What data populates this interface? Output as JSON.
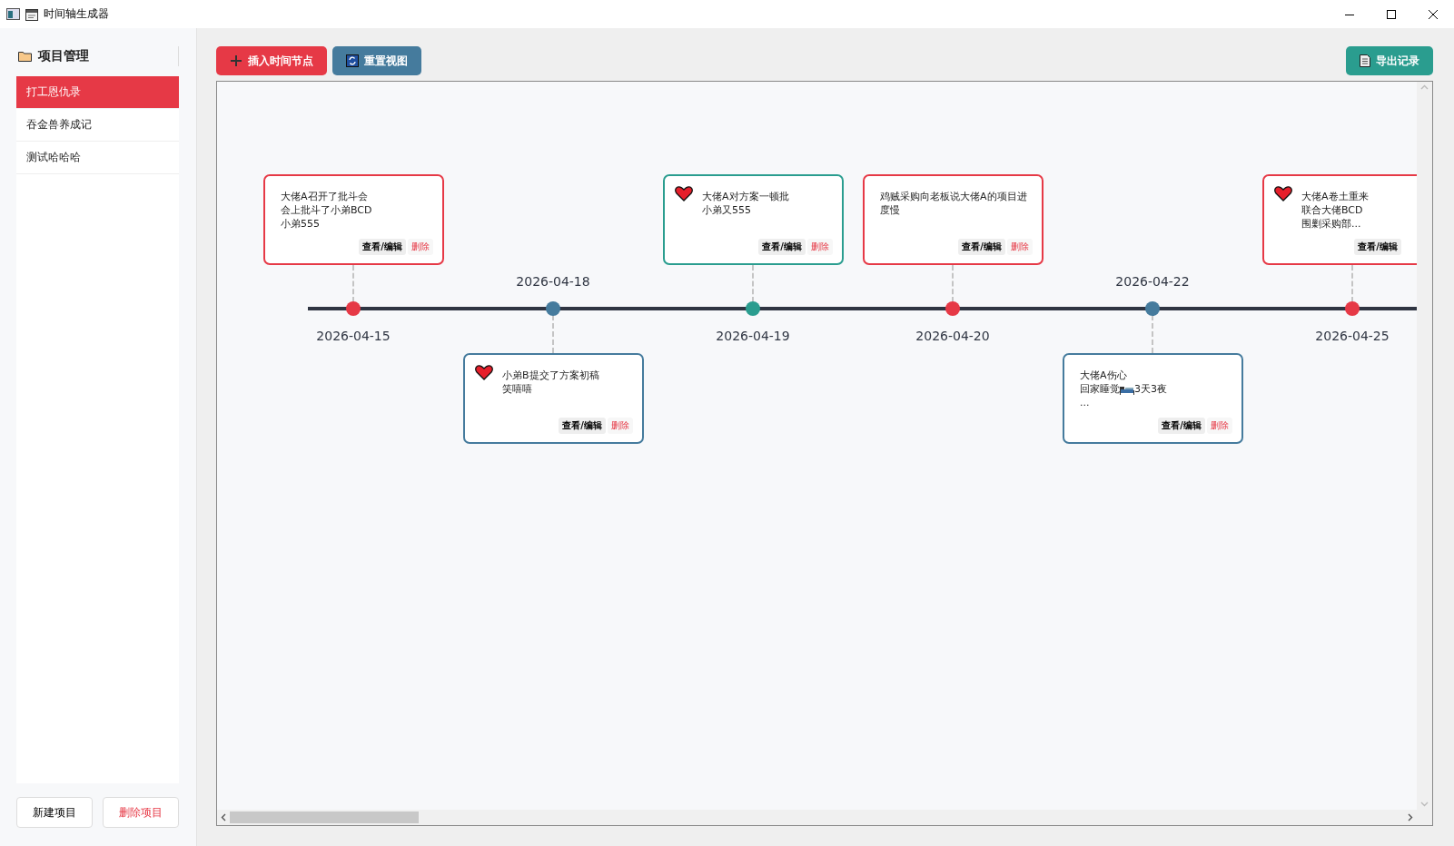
{
  "window": {
    "title": "时间轴生成器"
  },
  "sidebar": {
    "title": "项目管理",
    "items": [
      {
        "label": "打工恩仇录",
        "selected": true
      },
      {
        "label": "吞金兽养成记",
        "selected": false
      },
      {
        "label": "测试哈哈哈",
        "selected": false
      }
    ],
    "buttons": [
      {
        "label": "新建项目",
        "kind": "normal"
      },
      {
        "label": "删除项目",
        "kind": "danger"
      }
    ]
  },
  "toolbar": {
    "left": [
      {
        "label": "插入时间节点",
        "kind": "insert"
      },
      {
        "label": "重置视图",
        "kind": "reset"
      }
    ],
    "right": [
      {
        "label": "导出记录",
        "kind": "export"
      }
    ]
  },
  "timeline": {
    "events": [
      {
        "date": "2026-04-15",
        "kind": "above",
        "color": "#e63946",
        "starred": false,
        "lines": [
          "大佬A召开了批斗会",
          "会上批斗了小弟BCD",
          "小弟555"
        ],
        "edit": "查看/编辑",
        "delete": "删除"
      },
      {
        "date": "2026-04-18",
        "kind": "below",
        "color": "#457b9d",
        "starred": true,
        "lines": [
          "小弟B提交了方案初稿",
          "笑嘻嘻"
        ],
        "edit": "查看/编辑",
        "delete": "删除"
      },
      {
        "date": "2026-04-19",
        "kind": "above",
        "color": "#2a9d8f",
        "starred": true,
        "lines": [
          "大佬A对方案一顿批",
          "小弟又555"
        ],
        "edit": "查看/编辑",
        "delete": "删除"
      },
      {
        "date": "2026-04-20",
        "kind": "above",
        "color": "#e63946",
        "starred": false,
        "lines": [
          "鸡贼采购向老板说大佬A的项目进度慢"
        ],
        "edit": "查看/编辑",
        "delete": "删除"
      },
      {
        "date": "2026-04-22",
        "kind": "below",
        "color": "#457b9d",
        "starred": false,
        "lines": [
          "大佬A伤心",
          {
            "parts": [
              "回家睡觉",
              "3天3夜"
            ],
            "kind": "with-bed"
          },
          "..."
        ],
        "edit": "查看/编辑",
        "delete": "删除"
      },
      {
        "date": "2026-04-25",
        "kind": "above",
        "color": "#e63946",
        "starred": true,
        "lines": [
          "大佬A卷土重来",
          "联合大佬BCD",
          "围剿采购部..."
        ],
        "edit": "查看/编辑"
      }
    ]
  }
}
